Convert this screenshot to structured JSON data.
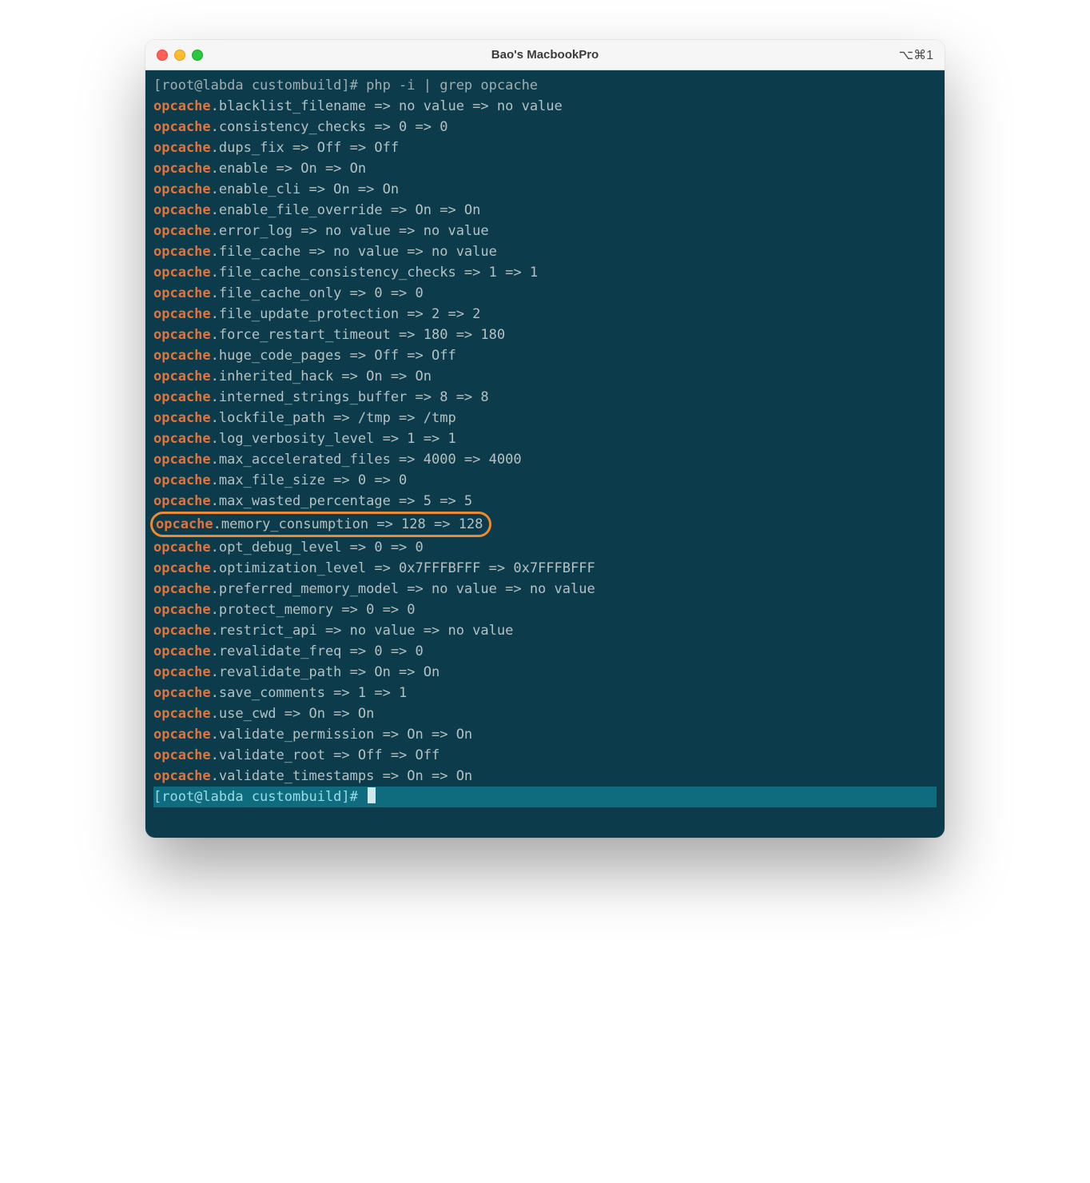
{
  "window": {
    "title": "Bao's MacbookPro",
    "shortcut": "⌥⌘1"
  },
  "prompt_head": {
    "prefix": "[root@labda custombuild]# ",
    "command": "php -i | grep opcache"
  },
  "keyword": "opcache",
  "lines": [
    ".blacklist_filename => no value => no value",
    ".consistency_checks => 0 => 0",
    ".dups_fix => Off => Off",
    ".enable => On => On",
    ".enable_cli => On => On",
    ".enable_file_override => On => On",
    ".error_log => no value => no value",
    ".file_cache => no value => no value",
    ".file_cache_consistency_checks => 1 => 1",
    ".file_cache_only => 0 => 0",
    ".file_update_protection => 2 => 2",
    ".force_restart_timeout => 180 => 180",
    ".huge_code_pages => Off => Off",
    ".inherited_hack => On => On",
    ".interned_strings_buffer => 8 => 8",
    ".lockfile_path => /tmp => /tmp",
    ".log_verbosity_level => 1 => 1",
    ".max_accelerated_files => 4000 => 4000",
    ".max_file_size => 0 => 0",
    ".max_wasted_percentage => 5 => 5",
    ".memory_consumption => 128 => 128",
    ".opt_debug_level => 0 => 0",
    ".optimization_level => 0x7FFFBFFF => 0x7FFFBFFF",
    ".preferred_memory_model => no value => no value",
    ".protect_memory => 0 => 0",
    ".restrict_api => no value => no value",
    ".revalidate_freq => 0 => 0",
    ".revalidate_path => On => On",
    ".save_comments => 1 => 1",
    ".use_cwd => On => On",
    ".validate_permission => On => On",
    ".validate_root => Off => Off",
    ".validate_timestamps => On => On"
  ],
  "highlight_index": 20,
  "prompt_tail": "[root@labda custombuild]# "
}
